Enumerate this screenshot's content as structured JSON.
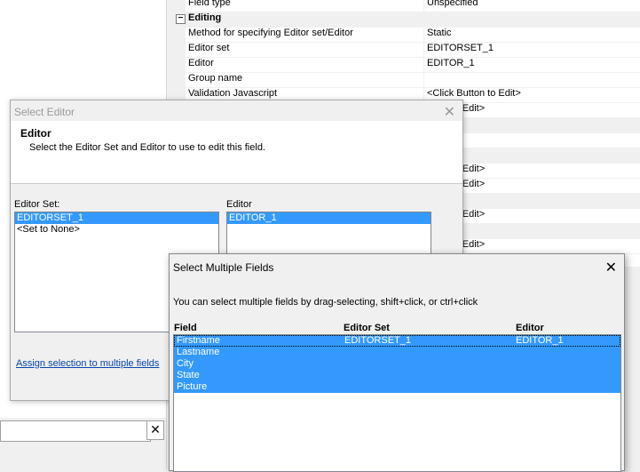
{
  "property_grid": {
    "rows": [
      {
        "type": "prop",
        "key": "Field type",
        "value": "Unspecified"
      },
      {
        "type": "cat",
        "key": "Editing",
        "value": ""
      },
      {
        "type": "prop",
        "key": "Method for specifying Editor set/Editor",
        "value": "Static"
      },
      {
        "type": "prop",
        "key": "Editor set",
        "value": "EDITORSET_1"
      },
      {
        "type": "prop",
        "key": "Editor",
        "value": "EDITOR_1"
      },
      {
        "type": "prop",
        "key": "Group name",
        "value": ""
      },
      {
        "type": "prop",
        "key": "Validation Javascript",
        "value": "<Click Button to Edit>"
      },
      {
        "type": "prop",
        "key": "",
        "value": "utton to Edit>"
      },
      {
        "type": "cat",
        "key": "",
        "value": ""
      },
      {
        "type": "prop",
        "key": "",
        "value": ""
      },
      {
        "type": "cat",
        "key": "",
        "value": ""
      },
      {
        "type": "prop",
        "key": "",
        "value": "utton to Edit>"
      },
      {
        "type": "prop",
        "key": "",
        "value": "utton to Edit>"
      },
      {
        "type": "cat",
        "key": "",
        "value": ""
      },
      {
        "type": "prop",
        "key": "",
        "value": "utton to Edit>"
      },
      {
        "type": "cat",
        "key": "",
        "value": ""
      },
      {
        "type": "prop",
        "key": "",
        "value": "utton to Edit>"
      }
    ],
    "collapse_symbol": "−"
  },
  "select_editor": {
    "title": "Select Editor",
    "close_glyph": "✕",
    "header_title": "Editor",
    "header_desc": "Select the Editor Set and Editor to use to edit this field.",
    "editor_set_label": "Editor Set:",
    "editor_set_items": [
      "EDITORSET_1",
      "<Set to None>"
    ],
    "editor_set_selected": 0,
    "editor_label": "Editor",
    "editor_items": [
      "EDITOR_1"
    ],
    "editor_selected": 0,
    "assign_link": "Assign selection to multiple fields"
  },
  "multi_fields": {
    "title": "Select Multiple Fields",
    "close_glyph": "✕",
    "description": "You can select multiple fields by drag-selecting, shift+click, or ctrl+click",
    "columns": [
      "Field",
      "Editor Set",
      "Editor"
    ],
    "rows": [
      {
        "field": "Firstname",
        "editor_set": "EDITORSET_1",
        "editor": "EDITOR_1",
        "focused": true
      },
      {
        "field": "Lastname",
        "editor_set": "",
        "editor": "",
        "focused": false
      },
      {
        "field": "City",
        "editor_set": "",
        "editor": "",
        "focused": false
      },
      {
        "field": "State",
        "editor_set": "",
        "editor": "",
        "focused": false
      },
      {
        "field": "Picture",
        "editor_set": "",
        "editor": "",
        "focused": false
      }
    ]
  },
  "bottom_search": {
    "value": "",
    "clear_glyph": "✕"
  },
  "colors": {
    "selection": "#3399ff",
    "link": "#0645ad"
  }
}
